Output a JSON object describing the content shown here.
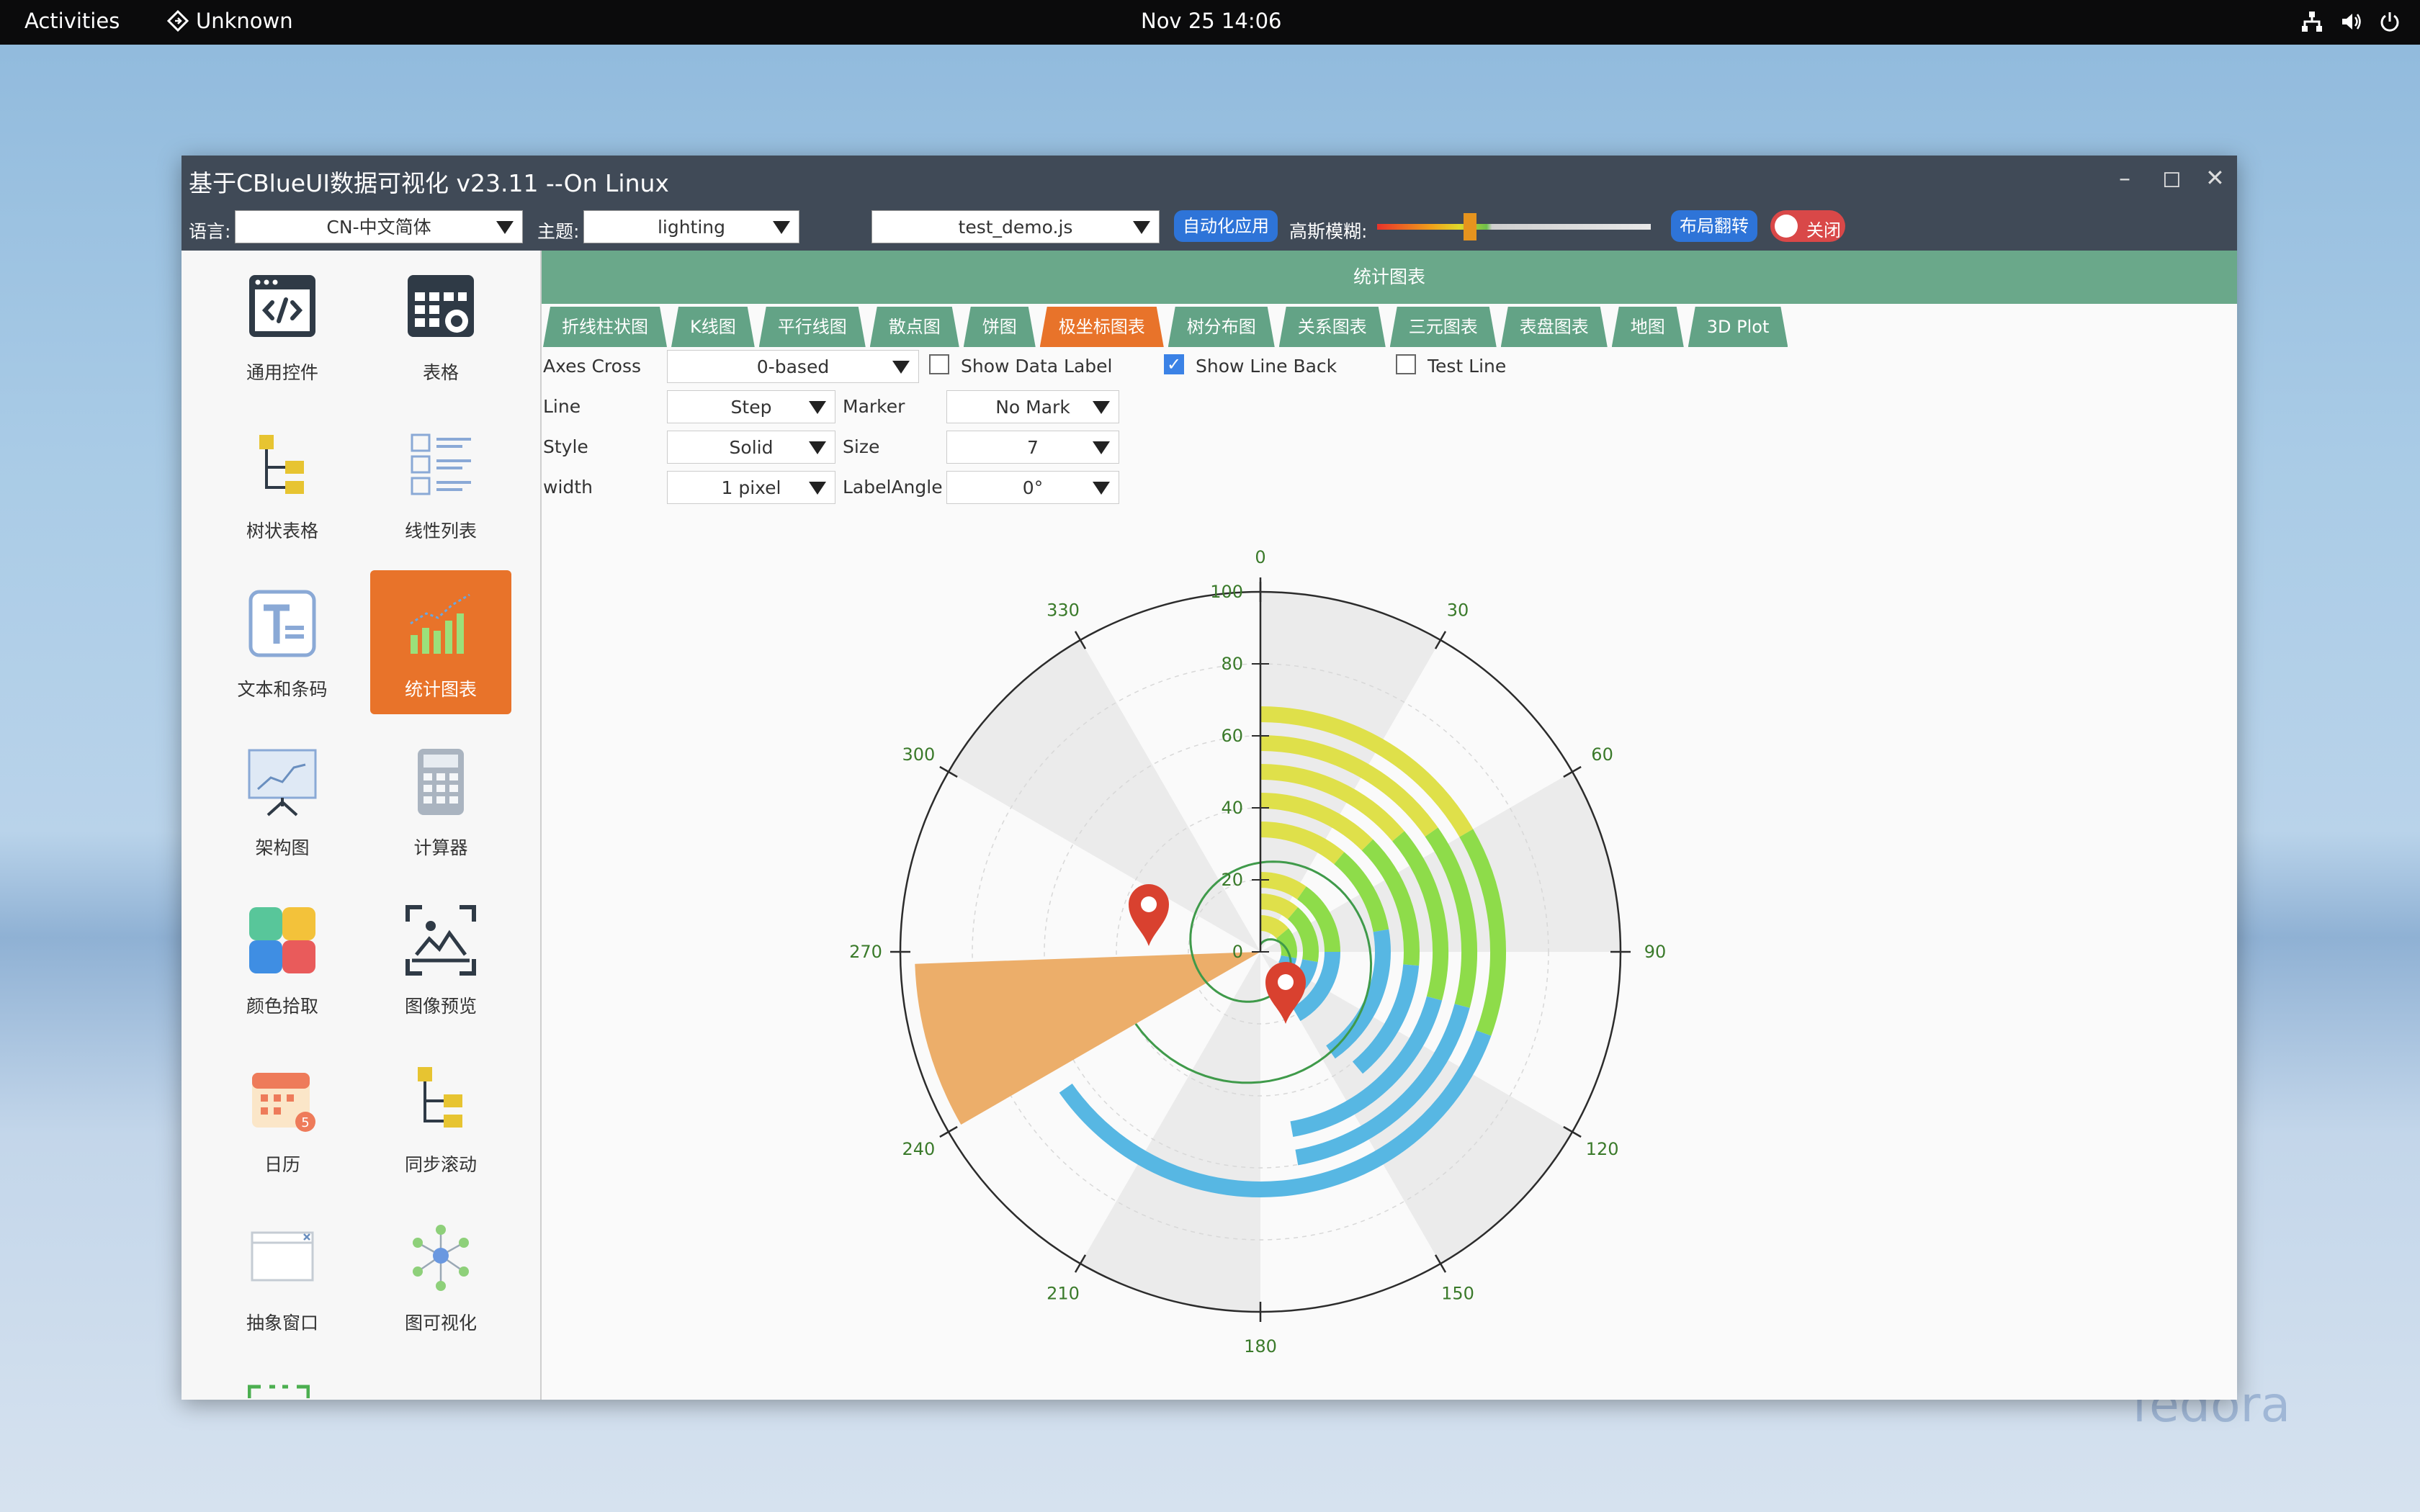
{
  "topbar": {
    "activities": "Activities",
    "app_name": "Unknown",
    "clock": "Nov 25  14:06"
  },
  "watermark": "fedora",
  "window": {
    "title": "基于CBlueUI数据可视化 v23.11 --On Linux",
    "toolbar": {
      "language_label": "语言:",
      "language_value": "CN-中文简体",
      "theme_label": "主题:",
      "theme_value": "lighting",
      "script_value": "test_demo.js",
      "auto_apply": "自动化应用",
      "blur_label": "高斯模糊:",
      "layout_flip": "布局翻转",
      "close_toggle": "关闭"
    }
  },
  "sidebar": {
    "items": [
      {
        "label": "通用控件",
        "icon": "code-window-icon"
      },
      {
        "label": "表格",
        "icon": "calendar-gear-icon"
      },
      {
        "label": "树状表格",
        "icon": "tree-table-icon"
      },
      {
        "label": "线性列表",
        "icon": "list-icon"
      },
      {
        "label": "文本和条码",
        "icon": "text-icon"
      },
      {
        "label": "统计图表",
        "icon": "bar-chart-icon"
      },
      {
        "label": "架构图",
        "icon": "presentation-icon"
      },
      {
        "label": "计算器",
        "icon": "calculator-icon"
      },
      {
        "label": "颜色拾取",
        "icon": "color-palette-icon"
      },
      {
        "label": "图像预览",
        "icon": "image-preview-icon"
      },
      {
        "label": "日历",
        "icon": "calendar-icon"
      },
      {
        "label": "同步滚动",
        "icon": "sync-scroll-icon"
      },
      {
        "label": "抽象窗口",
        "icon": "abstract-window-icon"
      },
      {
        "label": "图可视化",
        "icon": "graph-icon"
      }
    ]
  },
  "content": {
    "header": "统计图表",
    "tabs": [
      "折线柱状图",
      "K线图",
      "平行线图",
      "散点图",
      "饼图",
      "极坐标图表",
      "树分布图",
      "关系图表",
      "三元图表",
      "表盘图表",
      "地图",
      "3D Plot"
    ],
    "controls": {
      "axes_cross_label": "Axes Cross",
      "axes_cross_value": "0-based",
      "show_data_label": "Show Data Label",
      "show_line_back": "Show Line Back",
      "test_line": "Test Line",
      "line_label": "Line",
      "line_value": "Step",
      "style_label": "Style",
      "style_value": "Solid",
      "width_label": "width",
      "width_value": "1 pixel",
      "marker_label": "Marker",
      "marker_value": "No Mark",
      "size_label": "Size",
      "size_value": "7",
      "labelangle_label": "LabelAngle",
      "labelangle_value": "0°"
    }
  },
  "chart_data": {
    "type": "polar",
    "angular_ticks": [
      "0",
      "30",
      "60",
      "90",
      "120",
      "150",
      "180",
      "210",
      "240",
      "270",
      "300",
      "330"
    ],
    "radial_ticks": [
      "0",
      "20",
      "40",
      "60",
      "80",
      "100"
    ],
    "rlim": [
      0,
      100
    ],
    "colors": {
      "yellow": "#dfe04a",
      "green": "#8edc4a",
      "blue": "#57b7e3",
      "orange": "#ecae6a",
      "band": "#ebebeb",
      "spiral": "#3f9a4a",
      "marker": "#d9412f"
    }
  }
}
